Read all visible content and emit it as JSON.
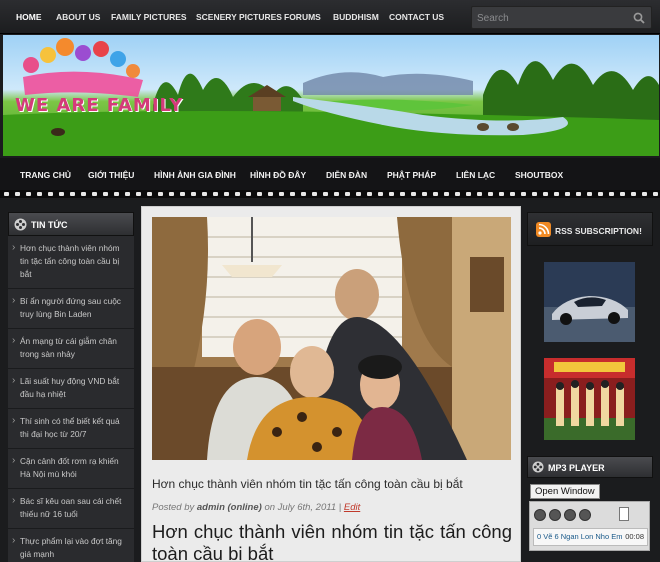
{
  "top_nav": {
    "items": [
      "HOME",
      "ABOUT US",
      "FAMILY PICTURES",
      "SCENERY PICTURES",
      "FORUMS",
      "BUDDHISM",
      "CONTACT US"
    ],
    "search_placeholder": "Search"
  },
  "banner": {
    "logo_text": "WE ARE FAMILY"
  },
  "main_nav": {
    "items": [
      "TRANG CHỦ",
      "GIỚI THIỆU",
      "HÌNH ẢNH GIA ĐÌNH",
      "HÌNH ĐỒ ĐÂY",
      "DIỄN ĐÀN",
      "PHẬT PHÁP",
      "LIÊN LẠC",
      "SHOUTBOX"
    ]
  },
  "news_widget": {
    "title": "TIN TỨC",
    "items": [
      "Hơn chục thành viên nhóm tin tặc tấn công toàn cầu bị bắt",
      "Bí ẩn người đứng sau cuộc truy lùng Bin Laden",
      "Án mạng từ cái giẫm chân trong sàn nhảy",
      "Lãi suất huy động VND bắt đầu hạ nhiệt",
      "Thí sinh có thể biết kết quả thi đại học từ 20/7",
      "Cận cảnh đốt rơm rạ khiến Hà Nội mù khói",
      "Bác sĩ kêu oan sau cái chết thiếu nữ 16 tuổi",
      "Thực phẩm lại vào đợt tăng giá mạnh"
    ]
  },
  "post": {
    "title": "Hơn chục thành viên nhóm tin tặc tấn công toàn cầu bị bắt",
    "meta_prefix": "Posted by",
    "author": "admin (online)",
    "date": "on July 6th, 2011 |",
    "edit_label": "Edit",
    "headline": "Hơn chục thành viên nhóm tin tặc tấn công toàn cầu bị bắt"
  },
  "rss": {
    "title": "RSS SUBSCRIPTION!"
  },
  "mp3": {
    "title": "MP3 PLAYER",
    "open_button": "Open Window",
    "track": "0 Vẽ 6 Ngan Lon Nho Em",
    "time": "00:08"
  }
}
